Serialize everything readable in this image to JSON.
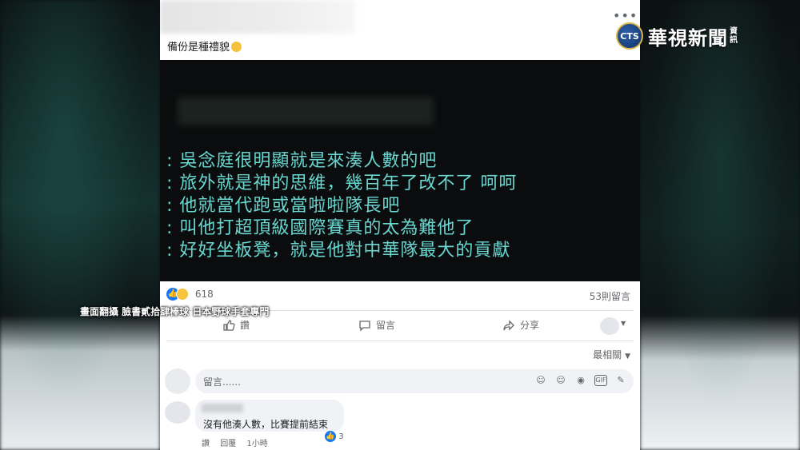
{
  "post": {
    "caption": "備份是種禮貌",
    "caption_emoji": "flushed-face-emoji",
    "quote_lines": [
      ": 吳念庭很明顯就是來湊人數的吧",
      ": 旅外就是神的思維，幾百年了改不了 呵呵",
      ": 他就當代跑或當啦啦隊長吧",
      ": 叫他打超頂級國際賽真的太為難他了",
      ": 好好坐板凳，就是他對中華隊最大的貢獻"
    ],
    "reaction_count": "618",
    "comments_count": "53則留言",
    "actions": {
      "like": "讚",
      "comment": "留言",
      "share": "分享"
    },
    "sort_label": "最相關",
    "composer_placeholder": "留言......",
    "comment": {
      "text": "沒有他湊人數，比賽提前結束",
      "like_label": "讚",
      "reply_label": "回覆",
      "time": "1小時",
      "reaction_count": "3"
    }
  },
  "overlay": {
    "logo_abbr": "CTS",
    "logo_name": "華視新聞",
    "logo_side_top": "資",
    "logo_side_bottom": "訊",
    "source_caption": "畫面翻攝 臉書貳拾肆棒球 日本野球手套專門"
  },
  "colors": {
    "quote_text": "#69d6cf",
    "facebook_blue": "#1877f2",
    "image_bg": "#0a0c0d"
  }
}
